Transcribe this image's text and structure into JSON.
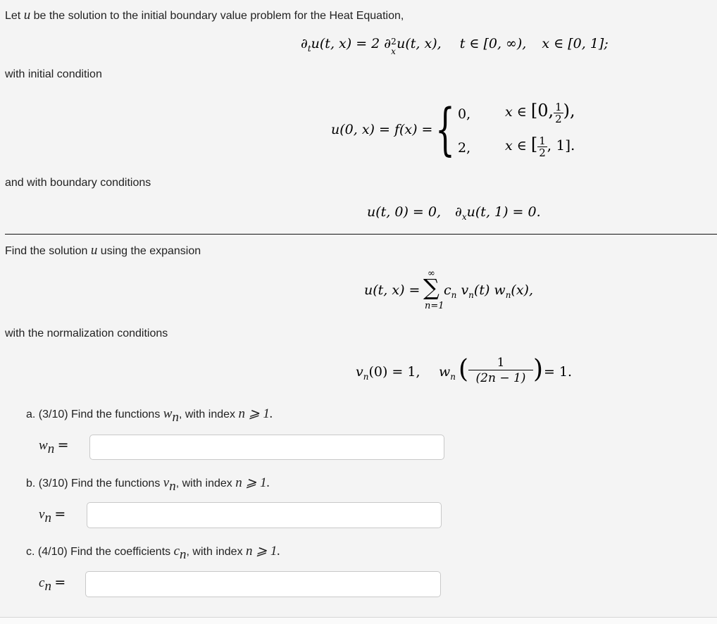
{
  "problem": {
    "intro_prefix": "Let ",
    "intro_var": "u",
    "intro_suffix": " be the solution to the initial boundary value problem for the Heat Equation,",
    "heat_equation": {
      "lhs": "∂",
      "lhs_sub": "t",
      "lhs_rest": "u(t, x) = 2 ∂",
      "rhs_sup": "2",
      "rhs_sub": "x",
      "rhs_rest": "u(t, x),",
      "domain_t": "t ∈ [0, ∞),",
      "domain_x": "x ∈ [0, 1];"
    },
    "initial_label": "with initial condition",
    "initial_condition": {
      "lhs": "u(0, x) = f(x) =",
      "case1_value": "0,",
      "case1_domain_prefix": "x ∈ ",
      "case1_interval_open": "[0,",
      "case1_frac_num": "1",
      "case1_frac_den": "2",
      "case1_interval_close": "),",
      "case2_value": "2,",
      "case2_domain_prefix": "x ∈ ",
      "case2_interval_open": "[",
      "case2_frac_num": "1",
      "case2_frac_den": "2",
      "case2_interval_close": ", 1].",
      "brace": "{"
    },
    "boundary_label": "and with boundary conditions",
    "boundary_conditions": {
      "bc1": "u(t, 0) = 0,",
      "bc2_prefix": "∂",
      "bc2_sub": "x",
      "bc2_rest": "u(t, 1) = 0."
    },
    "expansion_label_prefix": "Find the solution ",
    "expansion_label_var": "u",
    "expansion_label_suffix": " using the expansion",
    "expansion": {
      "lhs": "u(t, x) =",
      "sigma": "∑",
      "upper": "∞",
      "lower": "n=1",
      "term": "c",
      "term_sub": "n",
      "term_v": "v",
      "term_v_sub": "n",
      "term_v_arg": "(t)",
      "term_w": "w",
      "term_w_sub": "n",
      "term_w_arg": "(x),"
    },
    "normalization_label": "with the normalization conditions",
    "normalization": {
      "v_cond_var": "v",
      "v_cond_sub": "n",
      "v_cond_rest": "(0) = 1,",
      "w_cond_var": "w",
      "w_cond_sub": "n",
      "w_frac_num": "1",
      "w_frac_den": "(2n − 1)",
      "w_cond_rest": "= 1."
    }
  },
  "parts": [
    {
      "prefix": "a. (3/10) Find the functions ",
      "var": "w",
      "var_sub": "n",
      "suffix": ", with index ",
      "index": "n ⩾ 1.",
      "answer_label": "w",
      "answer_label_sub": "n",
      "answer_eq": "=",
      "answer_value": ""
    },
    {
      "prefix": "b. (3/10) Find the functions ",
      "var": "v",
      "var_sub": "n",
      "suffix": ", with index ",
      "index": "n ⩾ 1.",
      "answer_label": "v",
      "answer_label_sub": "n",
      "answer_eq": "=",
      "answer_value": ""
    },
    {
      "prefix": "c. (4/10) Find the coefficients ",
      "var": "c",
      "var_sub": "n",
      "suffix": ", with index ",
      "index": "n ⩾ 1.",
      "answer_label": "c",
      "answer_label_sub": "n",
      "answer_eq": "=",
      "answer_value": ""
    }
  ]
}
